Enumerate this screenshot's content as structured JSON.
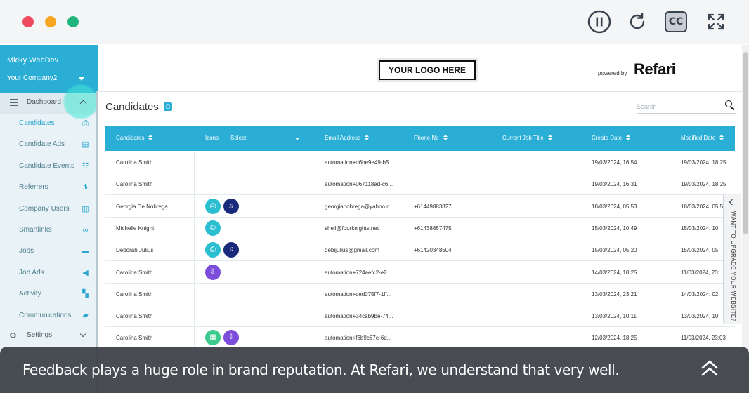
{
  "player": {
    "controls": {
      "cc_label": "CC"
    }
  },
  "sidebar": {
    "user_name": "Micky WebDev",
    "company": "Your Company2",
    "dashboard_label": "Dashboard",
    "items": [
      {
        "label": "Candidates",
        "icon": "candidate-badge-icon",
        "glyph": "⎙"
      },
      {
        "label": "Candidate Ads",
        "icon": "candidate-ad-icon",
        "glyph": "▤"
      },
      {
        "label": "Candidate Events",
        "icon": "group-icon",
        "glyph": "☷"
      },
      {
        "label": "Referrers",
        "icon": "hierarchy-icon",
        "glyph": "⋔"
      },
      {
        "label": "Company Users",
        "icon": "building-icon",
        "glyph": "▥"
      },
      {
        "label": "Smartlinks",
        "icon": "link-icon",
        "glyph": "∞"
      },
      {
        "label": "Jobs",
        "icon": "briefcase-icon",
        "glyph": "▬"
      },
      {
        "label": "Job Ads",
        "icon": "megaphone-icon",
        "glyph": "◀"
      },
      {
        "label": "Activity",
        "icon": "activity-icon",
        "glyph": "▚"
      },
      {
        "label": "Communications",
        "icon": "chat-icon",
        "glyph": "▰"
      }
    ],
    "settings_label": "Settings"
  },
  "header": {
    "logo_text": "YOUR LOGO HERE",
    "powered_by": "powered by",
    "brand": "Refari"
  },
  "page": {
    "title": "Candidates",
    "search_placeholder": "Search"
  },
  "table": {
    "columns": [
      "Candidates",
      "Icons",
      "Email Address",
      "Phone No",
      "Current Job Title",
      "Create Date",
      "Modified Date"
    ],
    "icons_select": "Select",
    "rows": [
      {
        "name": "Carolina Smith",
        "email": "automation+d6be9e49-b5...",
        "phone": "",
        "job": "",
        "created": "19/03/2024, 16:54",
        "modified": "19/03/2024, 18:25",
        "icons": []
      },
      {
        "name": "Carolina Smith",
        "email": "automation+067118ad-c6...",
        "phone": "",
        "job": "",
        "created": "19/03/2024, 16:31",
        "modified": "19/03/2024, 18:25",
        "icons": []
      },
      {
        "name": "Georgia De Nobrega",
        "email": "georgianobrega@yahoo.c...",
        "phone": "+61449883827",
        "job": "",
        "created": "18/03/2024, 05:53",
        "modified": "18/03/2024, 05:5",
        "icons": [
          "teal",
          "navy"
        ]
      },
      {
        "name": "Michelle Knight",
        "email": "shell@fourknights.net",
        "phone": "+61438857475",
        "job": "",
        "created": "15/03/2024, 10:49",
        "modified": "15/03/2024, 10:",
        "icons": [
          "teal"
        ]
      },
      {
        "name": "Deborah Julius",
        "email": "debijulius@gmail.com",
        "phone": "+61420348504",
        "job": "",
        "created": "15/03/2024, 05:20",
        "modified": "15/03/2024, 05:",
        "icons": [
          "teal",
          "navy"
        ]
      },
      {
        "name": "Carolina Smith",
        "email": "automation+724aefc2-e2...",
        "phone": "",
        "job": "",
        "created": "14/03/2024, 18:25",
        "modified": "11/03/2024, 23:",
        "icons": [
          "purple"
        ]
      },
      {
        "name": "Carolina Smith",
        "email": "automation+ced075f7-1ff...",
        "phone": "",
        "job": "",
        "created": "13/03/2024, 23:21",
        "modified": "14/03/2024, 02:",
        "icons": []
      },
      {
        "name": "Carolina Smith",
        "email": "automation+34cab9be-74...",
        "phone": "",
        "job": "",
        "created": "13/03/2024, 10:11",
        "modified": "13/03/2024, 10:",
        "icons": []
      },
      {
        "name": "Carolina Smith",
        "email": "automation+f6b9c67e-6d...",
        "phone": "",
        "job": "",
        "created": "12/03/2024, 18:25",
        "modified": "11/03/2024, 23:03",
        "icons": [
          "green",
          "purple"
        ]
      }
    ]
  },
  "upgrade_tab": "WANT TO UPGRADE YOUR WEBSITE?",
  "caption": "Feedback plays a huge role in brand reputation. At Refari, we understand that very well."
}
